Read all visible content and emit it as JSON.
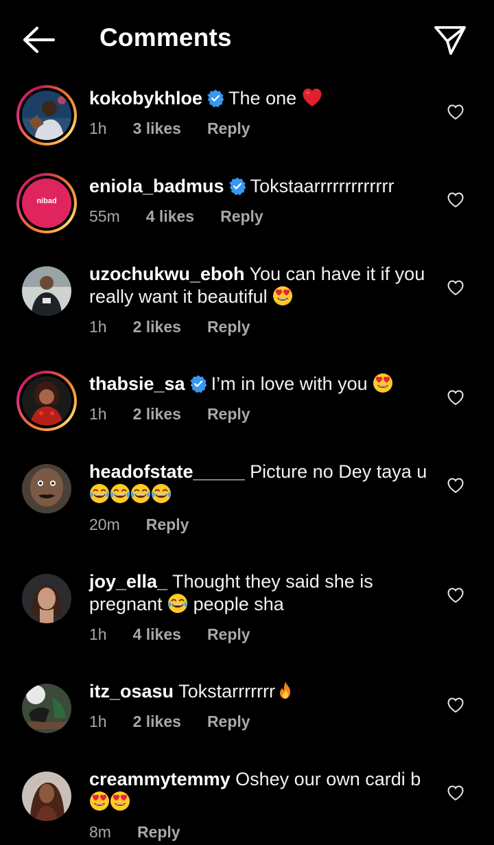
{
  "header": {
    "title": "Comments",
    "back_icon": "arrow-left-icon",
    "share_icon": "send-icon"
  },
  "colors": {
    "background": "#000000",
    "text": "#f5f5f5",
    "meta": "#a8a8a8",
    "verified": "#3897f0",
    "story_ring": [
      "#f58529",
      "#dd2a7b",
      "#feda75"
    ]
  },
  "comments": [
    {
      "username": "kokobykhloe",
      "verified": true,
      "text": "The one",
      "emoji_after": [
        "red-heart"
      ],
      "time": "1h",
      "likes": "3 likes",
      "reply": "Reply",
      "story_ring": true
    },
    {
      "username": "eniola_badmus",
      "verified": true,
      "text": "Tokstaarrrrrrrrrrrrr",
      "emoji_after": [],
      "time": "55m",
      "likes": "4 likes",
      "reply": "Reply",
      "story_ring": true,
      "avatar_logo_text": "nibad"
    },
    {
      "username": "uzochukwu_eboh",
      "verified": false,
      "text": "You can have it if you really want it beautiful",
      "emoji_after": [
        "heart-eyes"
      ],
      "time": "1h",
      "likes": "2 likes",
      "reply": "Reply",
      "story_ring": false
    },
    {
      "username": "thabsie_sa",
      "verified": true,
      "text": "I’m in love with you",
      "emoji_after": [
        "heart-eyes"
      ],
      "time": "1h",
      "likes": "2 likes",
      "reply": "Reply",
      "story_ring": true
    },
    {
      "username": "headofstate_____",
      "verified": false,
      "text": "Picture no Dey taya u",
      "emoji_after": [
        "tears-of-joy",
        "tears-of-joy",
        "tears-of-joy",
        "tears-of-joy"
      ],
      "time": "20m",
      "likes": "",
      "reply": "Reply",
      "story_ring": false
    },
    {
      "username": "joy_ella_",
      "verified": false,
      "text": "Thought they said she is pregnant",
      "emoji_mid": "tears-of-joy",
      "text_after": "people sha",
      "time": "1h",
      "likes": "4 likes",
      "reply": "Reply",
      "story_ring": false
    },
    {
      "username": "itz_osasu",
      "verified": false,
      "text": "Tokstarrrrrrr",
      "emoji_after": [
        "fire"
      ],
      "time": "1h",
      "likes": "2 likes",
      "reply": "Reply",
      "story_ring": false
    },
    {
      "username": "creammytemmy",
      "verified": false,
      "text": "Oshey our own cardi b",
      "emoji_after": [
        "heart-eyes",
        "heart-eyes"
      ],
      "time": "8m",
      "likes": "",
      "reply": "Reply",
      "story_ring": false
    }
  ]
}
